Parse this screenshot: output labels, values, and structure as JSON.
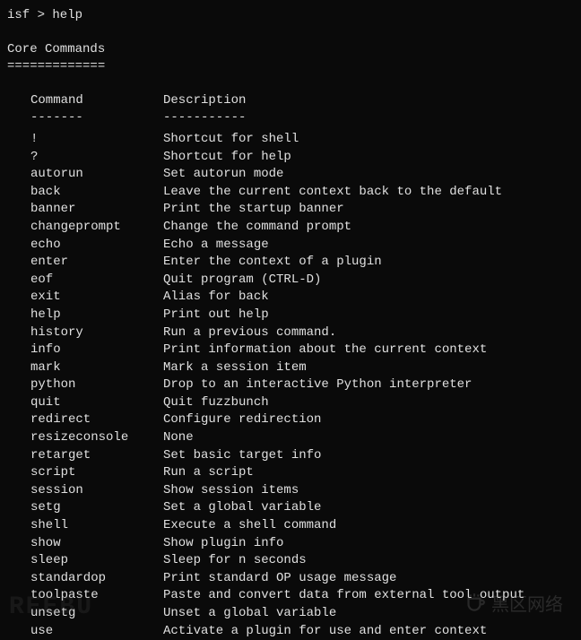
{
  "prompt": "isf > help",
  "section_title": "Core Commands",
  "section_underline": "=============",
  "header": {
    "cmd": "Command",
    "desc": "Description",
    "cmd_underline": "-------",
    "desc_underline": "-----------"
  },
  "commands": [
    {
      "cmd": "!",
      "desc": "Shortcut for shell"
    },
    {
      "cmd": "?",
      "desc": "Shortcut for help"
    },
    {
      "cmd": "autorun",
      "desc": "Set autorun mode"
    },
    {
      "cmd": "back",
      "desc": "Leave the current context back to the default"
    },
    {
      "cmd": "banner",
      "desc": "Print the startup banner"
    },
    {
      "cmd": "changeprompt",
      "desc": "Change the command prompt"
    },
    {
      "cmd": "echo",
      "desc": "Echo a message"
    },
    {
      "cmd": "enter",
      "desc": "Enter the context of a plugin"
    },
    {
      "cmd": "eof",
      "desc": "Quit program (CTRL-D)"
    },
    {
      "cmd": "exit",
      "desc": "Alias for back"
    },
    {
      "cmd": "help",
      "desc": "Print out help"
    },
    {
      "cmd": "history",
      "desc": "Run a previous command."
    },
    {
      "cmd": "info",
      "desc": "Print information about the current context"
    },
    {
      "cmd": "mark",
      "desc": "Mark a session item"
    },
    {
      "cmd": "python",
      "desc": "Drop to an interactive Python interpreter"
    },
    {
      "cmd": "quit",
      "desc": "Quit fuzzbunch"
    },
    {
      "cmd": "redirect",
      "desc": "Configure redirection"
    },
    {
      "cmd": "resizeconsole",
      "desc": "None"
    },
    {
      "cmd": "retarget",
      "desc": "Set basic target info"
    },
    {
      "cmd": "script",
      "desc": "Run a script"
    },
    {
      "cmd": "session",
      "desc": "Show session items"
    },
    {
      "cmd": "setg",
      "desc": "Set a global variable"
    },
    {
      "cmd": "shell",
      "desc": "Execute a shell command"
    },
    {
      "cmd": "show",
      "desc": "Show plugin info"
    },
    {
      "cmd": "sleep",
      "desc": "Sleep for n seconds"
    },
    {
      "cmd": "standardop",
      "desc": "Print standard OP usage message"
    },
    {
      "cmd": "toolpaste",
      "desc": "Paste and convert data from external tool output"
    },
    {
      "cmd": "unsetg",
      "desc": "Unset a global variable"
    },
    {
      "cmd": "use",
      "desc": "Activate a plugin for use and enter context"
    }
  ],
  "watermark_left": "REEBU",
  "watermark_right": "黑区网络"
}
